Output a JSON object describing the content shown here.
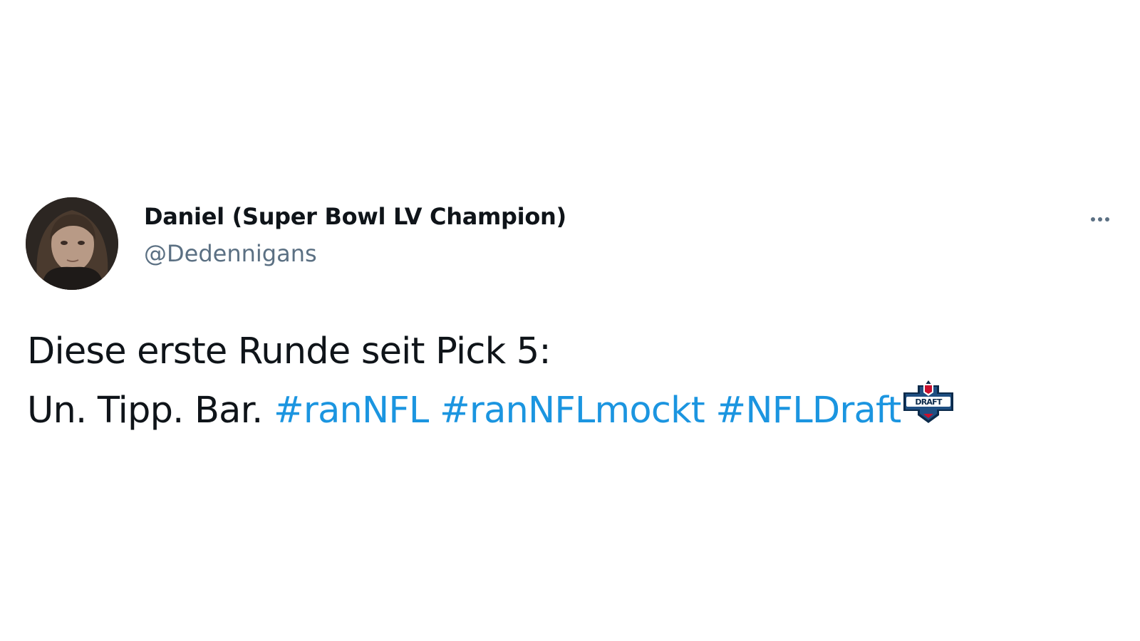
{
  "tweet": {
    "author": {
      "display_name": "Daniel (Super Bowl LV Champion)",
      "handle": "@Dedennigans"
    },
    "text": {
      "line1": "Diese erste Runde seit Pick 5:",
      "line2_prefix": "Un. Tipp. Bar.",
      "hashtags": [
        "#ranNFL",
        "#ranNFLmockt",
        "#NFLDraft"
      ]
    },
    "emoji": {
      "icon": "nfl-draft-emoji-icon",
      "text": "DRAFT"
    },
    "more_icon": "more-options-icon"
  },
  "colors": {
    "text": "#0f1419",
    "secondary": "#5b7083",
    "link": "#1b95e0",
    "background": "#ffffff"
  }
}
